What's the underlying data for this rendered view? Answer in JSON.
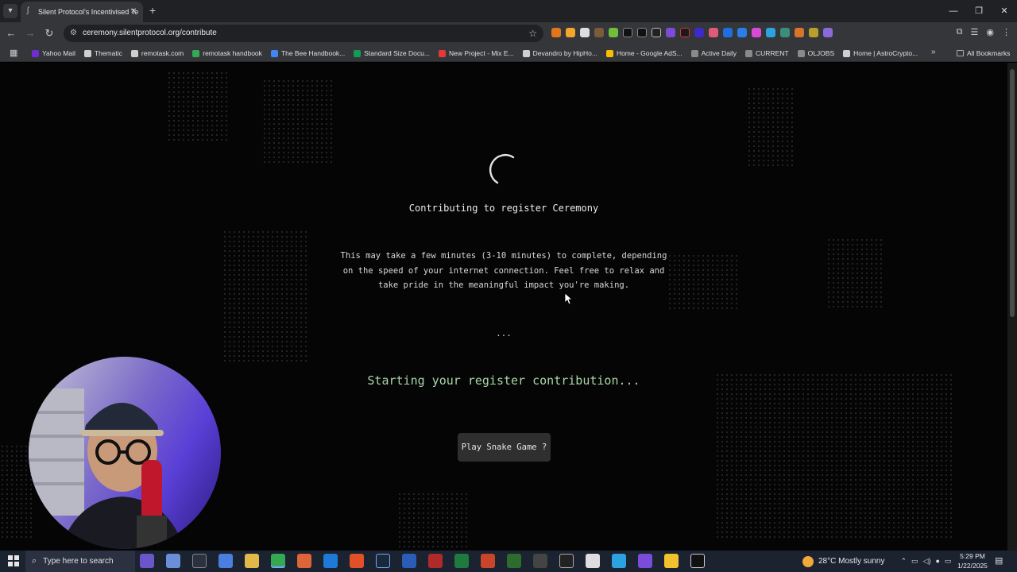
{
  "browser": {
    "tab_title": "Silent Protocol's Incentivised Te",
    "url": "ceremony.silentprotocol.org/contribute",
    "bookmarks": [
      {
        "label": "Yahoo Mail",
        "color": "#6d2ed6"
      },
      {
        "label": "Thematic",
        "color": "#cfcfcf"
      },
      {
        "label": "remotask.com",
        "color": "#cfcfcf"
      },
      {
        "label": "remotask handbook",
        "color": "#34a853"
      },
      {
        "label": "The Bee Handbook...",
        "color": "#4285f4"
      },
      {
        "label": "Standard Size Docu...",
        "color": "#0f9d58"
      },
      {
        "label": "New Project - Mix E...",
        "color": "#e53935"
      },
      {
        "label": "Devandro by HipHo...",
        "color": "#cfcfcf"
      },
      {
        "label": "Home - Google AdS...",
        "color": "#fbbc04"
      },
      {
        "label": "Active Daily",
        "color": "#8a8a8a"
      },
      {
        "label": "CURRENT",
        "color": "#8a8a8a"
      },
      {
        "label": "OLJOBS",
        "color": "#8a8a8a"
      },
      {
        "label": "Home | AstroCrypto...",
        "color": "#cfcfcf"
      }
    ],
    "all_bookmarks_label": "All Bookmarks"
  },
  "page": {
    "title": "Contributing to register Ceremony",
    "description": "This may take a few minutes (3-10 minutes) to complete, depending on the speed of your internet connection. Feel free to relax and take pride in the meaningful impact you're making.",
    "ellipsis": "...",
    "status": "Starting your register contribution...",
    "snake_button": "Play Snake Game ?",
    "accent_status_color": "#a9d7a9"
  },
  "taskbar": {
    "search_placeholder": "Type here to search",
    "weather": "28°C  Mostly sunny",
    "time": "5:29 PM",
    "date": "1/22/2025"
  }
}
